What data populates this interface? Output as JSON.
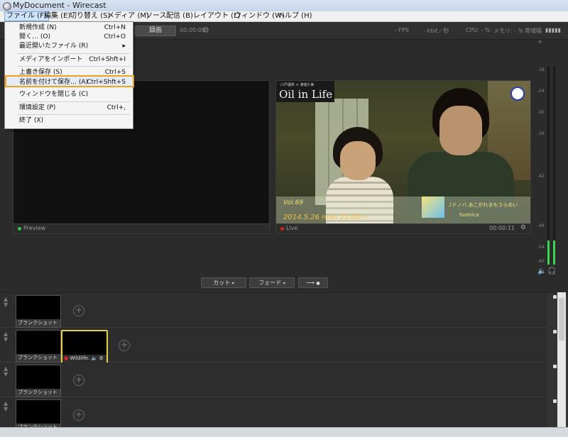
{
  "window": {
    "title": "MyDocument - Wirecast"
  },
  "menubar": {
    "items": [
      {
        "label": "ファイル (F)",
        "active": true
      },
      {
        "label": "編集 (E)"
      },
      {
        "label": "切り替え (S)"
      },
      {
        "label": "メディア (M)"
      },
      {
        "label": "ソース"
      },
      {
        "label": "配信 (B)"
      },
      {
        "label": "レイアウト (L)"
      },
      {
        "label": "ウィンドウ (W)"
      },
      {
        "label": "ヘルプ (H)"
      }
    ]
  },
  "toolbar": {
    "record_label": "録画",
    "timecode": "00:00:00",
    "fps": "- FPS",
    "bitrate": "- kbit／秒",
    "cpu": "CPU: - %",
    "memory": "メモリ: - %",
    "bandwidth": "帯域幅"
  },
  "file_menu": {
    "items": [
      {
        "label": "新規作成 (N)",
        "shortcut": "Ctrl+N"
      },
      {
        "label": "開く… (O)",
        "shortcut": "Ctrl+O"
      },
      {
        "label": "最近開いたファイル (R)",
        "shortcut": "▸"
      },
      {
        "label": "メディアをインポート",
        "shortcut": "Ctrl+Shft+I"
      },
      {
        "label": "上書き保存 (S)",
        "shortcut": "Ctrl+S"
      },
      {
        "label": "名前を付けて保存… (A)",
        "shortcut": "Ctrl+Shft+S",
        "highlighted": true
      },
      {
        "label": "ウィンドウを閉じる (C)",
        "shortcut": ""
      },
      {
        "label": "環境設定 (P)",
        "shortcut": "Ctrl+,"
      },
      {
        "label": "終了 (X)",
        "shortcut": ""
      }
    ]
  },
  "preview": {
    "label": "Preview"
  },
  "live": {
    "label": "Live",
    "timecode": "00:00:11",
    "video": {
      "logo_small": "川戸優希 × 津端久美",
      "logo_title": "Oil in Life",
      "vol": "Vol.69",
      "date": "2014.5.26  mon  21:00〜",
      "song": "♪ドノバ  あこがれまもうらめい",
      "artist": "huenica"
    }
  },
  "transport": {
    "cut_label": "カット",
    "fade_label": "フェード",
    "go_glyph": "⟶"
  },
  "meter": {
    "ticks": [
      "-6",
      "-18",
      "-24",
      "-30",
      "-36",
      "-42",
      "-48",
      "-54",
      "-60"
    ],
    "level": 0.12,
    "level_color": "#3bd24d"
  },
  "layers": [
    {
      "number": "1",
      "shots": [
        {
          "caption": "ブランクショット"
        }
      ]
    },
    {
      "number": "2",
      "shots": [
        {
          "caption": "ブランクショット"
        },
        {
          "caption": "Wildlife.",
          "selected": true
        }
      ]
    },
    {
      "number": "3",
      "shots": [
        {
          "caption": "ブランクショット"
        }
      ]
    },
    {
      "number": "4",
      "shots": [
        {
          "caption": "ブランクショット"
        }
      ]
    }
  ],
  "colors": {
    "highlight_border": "#f0a21c",
    "selected_shot_border": "#e6cf45",
    "preview_dot": "#2ecc40",
    "live_dot": "#e02020"
  }
}
